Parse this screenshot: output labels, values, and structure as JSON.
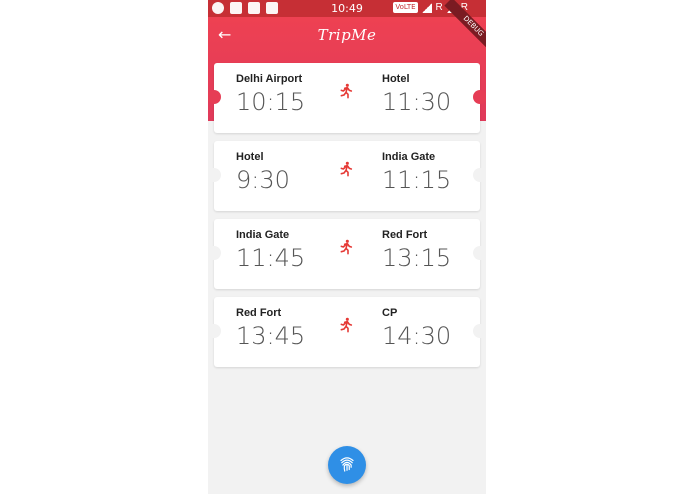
{
  "status_bar": {
    "time": "10:49",
    "network_badge": "VoLTE",
    "roaming_1": "R",
    "roaming_2": "R"
  },
  "app_bar": {
    "title": "TripMe",
    "back_icon": "arrow-left-icon",
    "debug_ribbon": "DEBUG"
  },
  "legs": [
    {
      "from": "Delhi Airport",
      "depart": "10:15",
      "to": "Hotel",
      "arrive": "11:30",
      "mode_icon": "walking-icon"
    },
    {
      "from": "Hotel",
      "depart": "9:30",
      "to": "India Gate",
      "arrive": "11:15",
      "mode_icon": "walking-icon"
    },
    {
      "from": "India Gate",
      "depart": "11:45",
      "to": "Red Fort",
      "arrive": "13:15",
      "mode_icon": "walking-icon"
    },
    {
      "from": "Red Fort",
      "depart": "13:45",
      "to": "CP",
      "arrive": "14:30",
      "mode_icon": "walking-icon"
    }
  ],
  "fab": {
    "icon": "fingerprint-icon"
  },
  "colors": {
    "header": "#ee4152",
    "status_bar": "#c62f35",
    "accent_icon": "#e53935",
    "fab": "#2f8fe6"
  }
}
